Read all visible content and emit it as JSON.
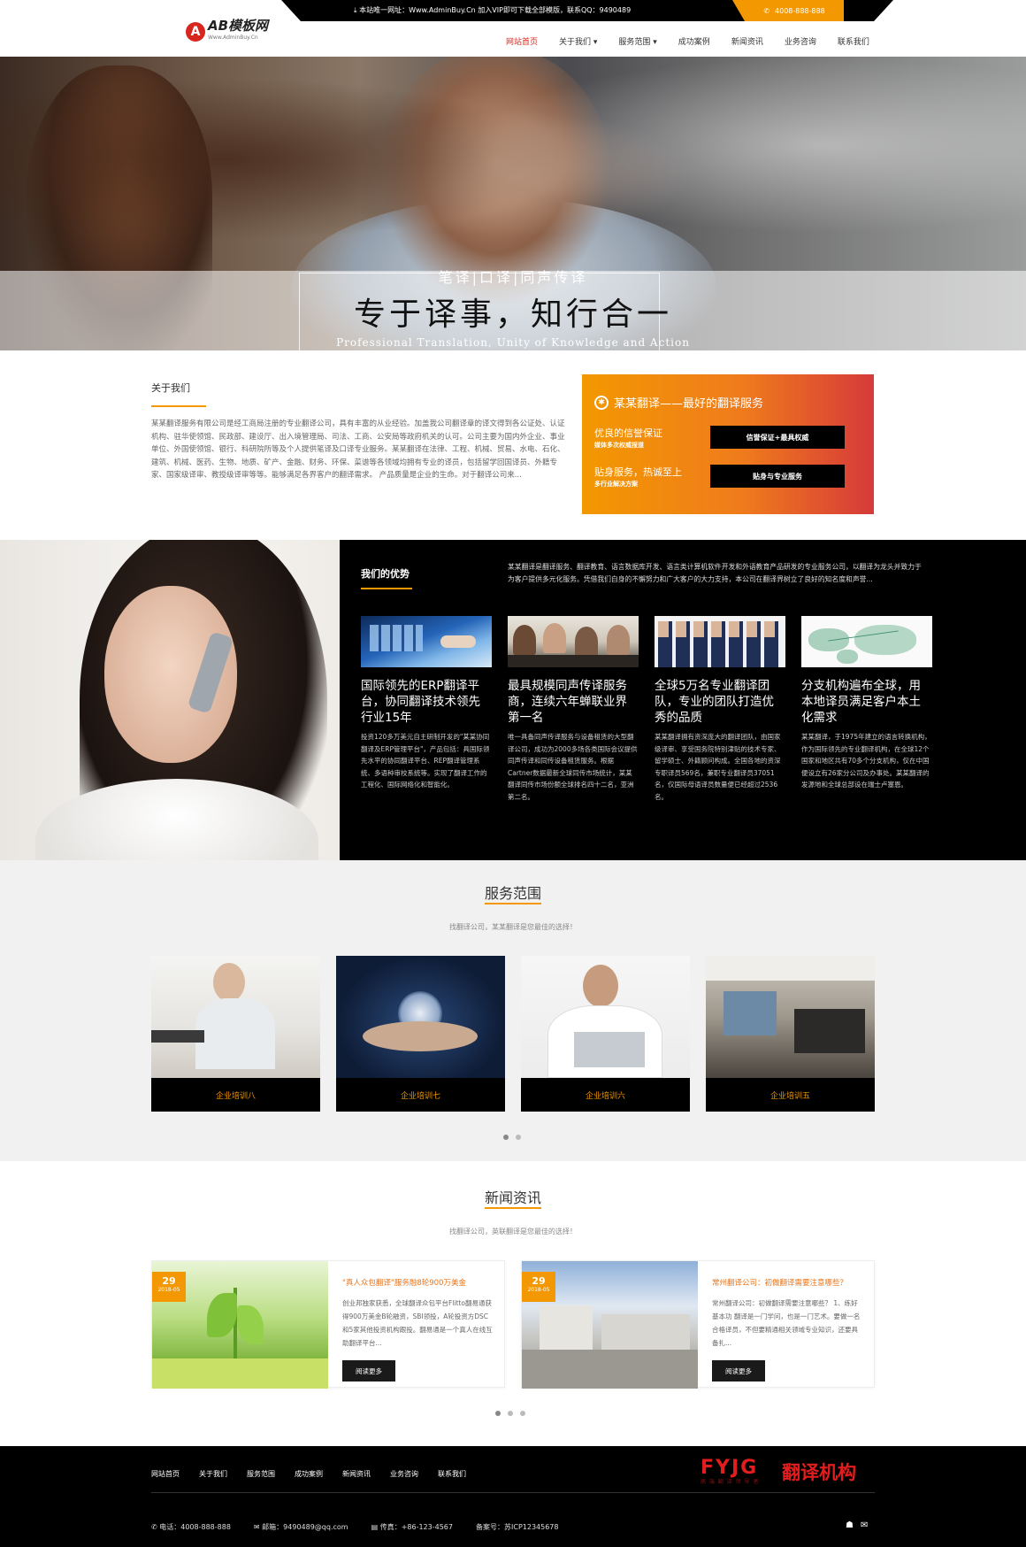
{
  "header": {
    "notice": "本站唯一网址：Www.AdminBuy.Cn 加入VIP即可下载全部模版，联系QQ：9490489",
    "phone": "4008-888-888",
    "logo_text": "AB模板网",
    "logo_sub": "Www.AdminBuy.Cn",
    "nav": [
      "网站首页",
      "关于我们 ▾",
      "服务范围 ▾",
      "成功案例",
      "新闻资讯",
      "业务咨询",
      "联系我们"
    ]
  },
  "hero": {
    "subtitle": "笔译|口译|同声传译",
    "title": "专于译事，知行合一",
    "english": "Professional Translation, Unity of Knowledge and Action"
  },
  "about": {
    "title": "关于我们",
    "text": "某某翻译服务有限公司是经工商局注册的专业翻译公司，具有丰富的从业经验。加盖我公司翻译章的译文得到各公证处、认证机构、驻华使领馆、民政部、建设厅、出入境管理局、司法、工商、公安局等政府机关的认可。公司主要为国内外企业、事业单位、外国使领馆、银行、科研院所等及个人提供笔译及口译专业服务。某某翻译在法律、工程、机械、贸易、水电、石化、建筑、机械、医药、生物、地质、矿产、金融、财务、环保、菜谱等各领域均拥有专业的译员，包括留学回国译员、外籍专家、国家级译审、教授级译审等等。能够满足各界客户的翻译需求。 产品质量是企业的生命。对于翻译公司来..."
  },
  "service_box": {
    "title": "某某翻译——最好的翻译服务",
    "line1": "优良的信誉保证",
    "line1_sub": "媒体多次权威报道",
    "button1": "信誉保证+最具权威",
    "line2": "贴身服务，热诚至上",
    "line2_sub": "多行业解决方案",
    "button2": "贴身与专业服务"
  },
  "advantages": {
    "title": "我们的优势",
    "intro": "某某翻译是翻译服务、翻译教育、语言数据库开发、语言类计算机软件开发和外语教育产品研发的专业服务公司，以翻译为龙头并致力于为客户提供多元化服务。凭借我们自身的不懈努力和广大客户的大力支持，本公司在翻译界树立了良好的知名度和声誉...",
    "cards": [
      {
        "title": "国际领先的ERP翻译平台，协同翻译技术领先行业15年",
        "text": "投资120多万美元自主研制开发的\"某某协同翻译及ERP管理平台\"，产品包括：具国际领先水平的协同翻译平台、REP翻译管理系统、多语种审校系统等。实现了翻译工作的工程化、国际网络化和智能化。"
      },
      {
        "title": "最具规模同声传译服务商，连续六年蝉联业界第一名",
        "text": "唯一具备同声传译服务与设备租赁的大型翻译公司，成功为2000多场各类国际会议提供同声传译和同传设备租赁服务。根据Cartner数据最新全球同传市场统计，某某翻译同传市场份额全球排名四十二名，亚洲第二名。"
      },
      {
        "title": "全球5万名专业翻译团队，专业的团队打造优秀的品质",
        "text": "某某翻译拥有资深庞大的翻译团队，由国家级译审、享受国务院特别津贴的技术专家、留学硕士、外籍顾问构成。全国各地的资深专职译员569名，兼职专业翻译员37051名，仅国际母语译员数量便已经超过2536名。"
      },
      {
        "title": "分支机构遍布全球，用本地译员满足客户本土化需求",
        "text": "某某翻译，于1975年建立的语言转换机构，作为国际领先的专业翻译机构，在全球12个国家和地区共有70多个分支机构，仅在中国便设立有26家分公司及办事处。某某翻译的发源地和全球总部设在瑞士卢塞恩。"
      }
    ]
  },
  "services": {
    "title": "服务范围",
    "subtitle": "找翻译公司，某某翻译是您最佳的选择！",
    "items": [
      "企业培训八",
      "企业培训七",
      "企业培训六",
      "企业培训五"
    ]
  },
  "news": {
    "title": "新闻资讯",
    "subtitle": "找翻译公司，英联翻译是您最佳的选择！",
    "items": [
      {
        "day": "29",
        "month": "2018-05",
        "title": "\"真人众包翻译\"服务融8轮900万美金",
        "text": "创业邦独家获悉，全球翻译众包平台Flitto翻易通获得900万美金B轮融资，SBI领投，A轮投资方DSC和5家其他投资机构跟投。翻易通是一个真人在线互助翻译平台...",
        "button": "阅读更多"
      },
      {
        "day": "29",
        "month": "2018-05",
        "title": "常州翻译公司：初做翻译需要注意哪些？",
        "text": "常州翻译公司：初做翻译需要注意哪些？ 1、练好基本功 翻译是一门学问，也是一门艺术。要做一名合格译员，不但要精通相关领域专业知识，还要具备扎...",
        "button": "阅读更多"
      }
    ]
  },
  "footer": {
    "nav": [
      "网站首页",
      "关于我们",
      "服务范围",
      "成功案例",
      "新闻资讯",
      "业务咨询",
      "联系我们"
    ],
    "logo_en": "FYJG",
    "logo_cn": "翻译机构",
    "logo_tiny": "高 端 翻 译 领 导 者",
    "phone": "电话：4008-888-888",
    "email": "邮箱：9490489@qq.com",
    "fax": "传真：+86-123-4567",
    "icp": "备案号：苏ICP12345678"
  },
  "colors": {
    "accent": "#f39800",
    "brand_red": "#d7261e",
    "dark": "#000000"
  }
}
